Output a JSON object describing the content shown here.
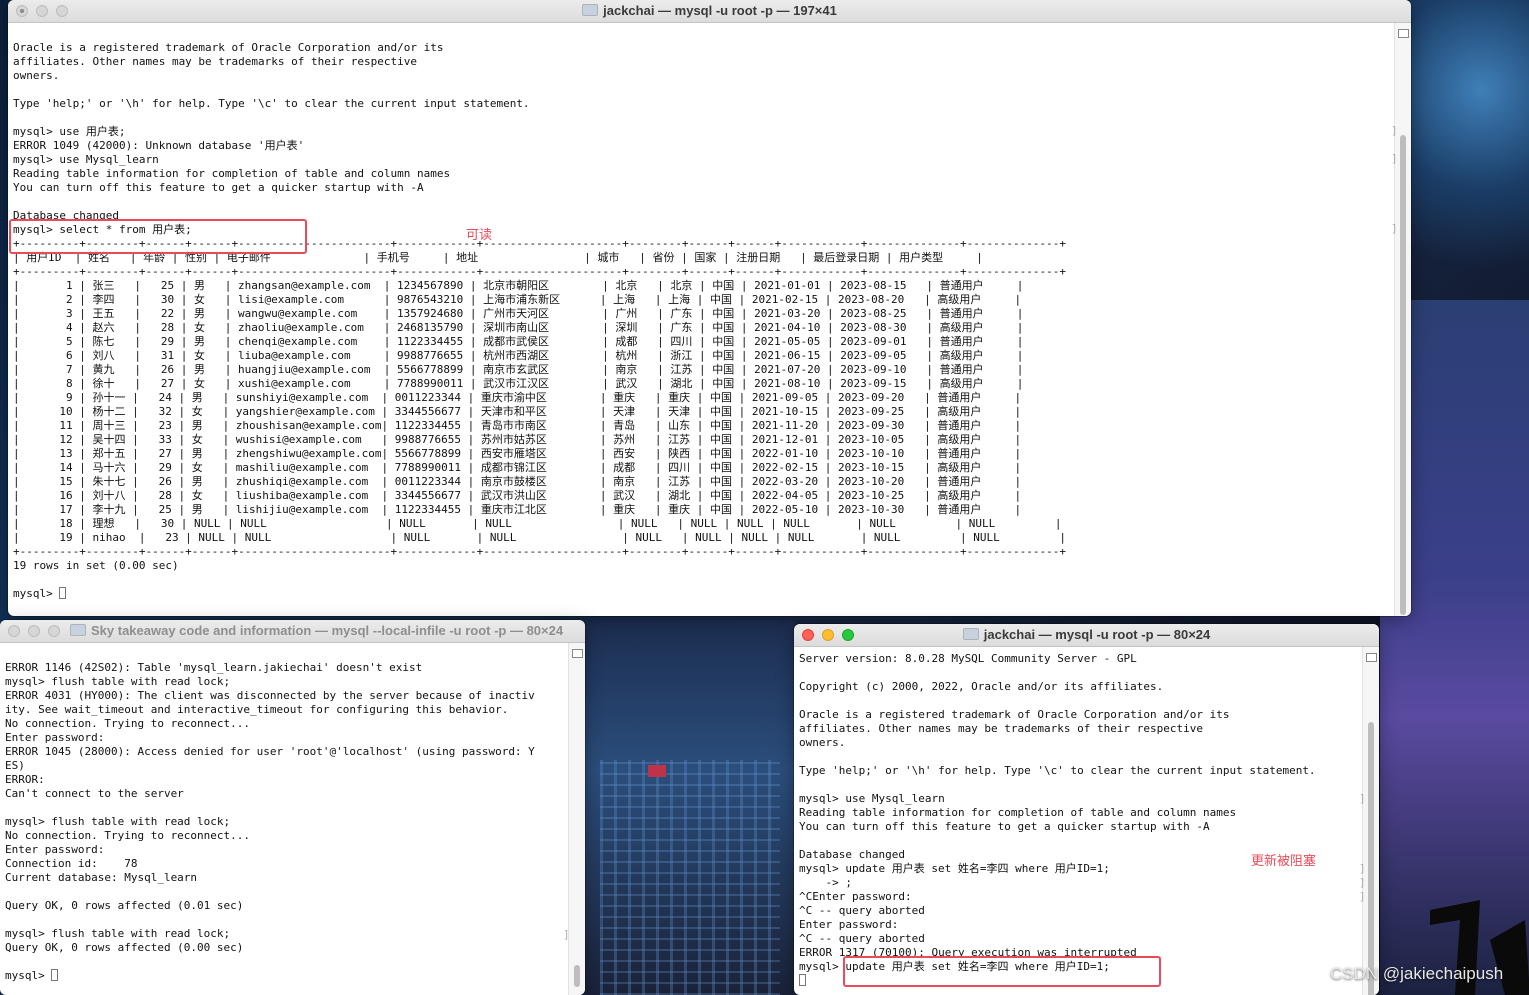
{
  "windows": {
    "main": {
      "title": "jackchai — mysql -u root -p — 197×41",
      "lines": [
        "",
        "Oracle is a registered trademark of Oracle Corporation and/or its",
        "affiliates. Other names may be trademarks of their respective",
        "owners.",
        "",
        "Type 'help;' or '\\h' for help. Type '\\c' to clear the current input statement.",
        "",
        "mysql> use 用户表;",
        "ERROR 1049 (42000): Unknown database '用户表'",
        "mysql> use Mysql_learn",
        "Reading table information for completion of table and column names",
        "You can turn off this feature to get a quicker startup with -A",
        "",
        "Database changed",
        "mysql> select * from 用户表;",
        "+---------+--------+------+------+-----------------------+------------+---------------------+--------+------+------+------------+--------------+--------------+",
        "| 用户ID  | 姓名   | 年龄 | 性别 | 电子邮件              | 手机号     | 地址                | 城市   | 省份 | 国家 | 注册日期   | 最后登录日期 | 用户类型     |",
        "+---------+--------+------+------+-----------------------+------------+---------------------+--------+------+------+------------+--------------+--------------+",
        "|       1 | 张三   |   25 | 男   | zhangsan@example.com  | 1234567890 | 北京市朝阳区        | 北京   | 北京 | 中国 | 2021-01-01 | 2023-08-15   | 普通用户     |",
        "|       2 | 李四   |   30 | 女   | lisi@example.com      | 9876543210 | 上海市浦东新区      | 上海   | 上海 | 中国 | 2021-02-15 | 2023-08-20   | 高级用户     |",
        "|       3 | 王五   |   22 | 男   | wangwu@example.com    | 1357924680 | 广州市天河区        | 广州   | 广东 | 中国 | 2021-03-20 | 2023-08-25   | 普通用户     |",
        "|       4 | 赵六   |   28 | 女   | zhaoliu@example.com   | 2468135790 | 深圳市南山区        | 深圳   | 广东 | 中国 | 2021-04-10 | 2023-08-30   | 高级用户     |",
        "|       5 | 陈七   |   29 | 男   | chenqi@example.com    | 1122334455 | 成都市武侯区        | 成都   | 四川 | 中国 | 2021-05-05 | 2023-09-01   | 普通用户     |",
        "|       6 | 刘八   |   31 | 女   | liuba@example.com     | 9988776655 | 杭州市西湖区        | 杭州   | 浙江 | 中国 | 2021-06-15 | 2023-09-05   | 高级用户     |",
        "|       7 | 黄九   |   26 | 男   | huangjiu@example.com  | 5566778899 | 南京市玄武区        | 南京   | 江苏 | 中国 | 2021-07-20 | 2023-09-10   | 普通用户     |",
        "|       8 | 徐十   |   27 | 女   | xushi@example.com     | 7788990011 | 武汉市江汉区        | 武汉   | 湖北 | 中国 | 2021-08-10 | 2023-09-15   | 高级用户     |",
        "|       9 | 孙十一 |   24 | 男   | sunshiyi@example.com  | 0011223344 | 重庆市渝中区        | 重庆   | 重庆 | 中国 | 2021-09-05 | 2023-09-20   | 普通用户     |",
        "|      10 | 杨十二 |   32 | 女   | yangshier@example.com | 3344556677 | 天津市和平区        | 天津   | 天津 | 中国 | 2021-10-15 | 2023-09-25   | 高级用户     |",
        "|      11 | 周十三 |   23 | 男   | zhoushisan@example.com| 1122334455 | 青岛市市南区        | 青岛   | 山东 | 中国 | 2021-11-20 | 2023-09-30   | 普通用户     |",
        "|      12 | 吴十四 |   33 | 女   | wushisi@example.com   | 9988776655 | 苏州市姑苏区        | 苏州   | 江苏 | 中国 | 2021-12-01 | 2023-10-05   | 高级用户     |",
        "|      13 | 郑十五 |   27 | 男   | zhengshiwu@example.com| 5566778899 | 西安市雁塔区        | 西安   | 陕西 | 中国 | 2022-01-10 | 2023-10-10   | 普通用户     |",
        "|      14 | 马十六 |   29 | 女   | mashiliu@example.com  | 7788990011 | 成都市锦江区        | 成都   | 四川 | 中国 | 2022-02-15 | 2023-10-15   | 高级用户     |",
        "|      15 | 朱十七 |   26 | 男   | zhushiqi@example.com  | 0011223344 | 南京市鼓楼区        | 南京   | 江苏 | 中国 | 2022-03-20 | 2023-10-20   | 普通用户     |",
        "|      16 | 刘十八 |   28 | 女   | liushiba@example.com  | 3344556677 | 武汉市洪山区        | 武汉   | 湖北 | 中国 | 2022-04-05 | 2023-10-25   | 高级用户     |",
        "|      17 | 李十九 |   25 | 男   | lishijiu@example.com  | 1122334455 | 重庆市江北区        | 重庆   | 重庆 | 中国 | 2022-05-10 | 2023-10-30   | 普通用户     |",
        "|      18 | 理想   |   30 | NULL | NULL                  | NULL       | NULL                | NULL   | NULL | NULL | NULL       | NULL         | NULL         |",
        "|      19 | nihao  |   23 | NULL | NULL                  | NULL       | NULL                | NULL   | NULL | NULL | NULL       | NULL         | NULL         |",
        "+---------+--------+------+------+-----------------------+------------+---------------------+--------+------+------+------------+--------------+--------------+",
        "19 rows in set (0.00 sec)",
        "",
        "mysql> "
      ],
      "annotation": "可读"
    },
    "left": {
      "title": "Sky takeaway code and information — mysql --local-infile -u root -p — 80×24",
      "lines": [
        "",
        "ERROR 1146 (42S02): Table 'mysql_learn.jakiechai' doesn't exist",
        "mysql> flush table with read lock;",
        "ERROR 4031 (HY000): The client was disconnected by the server because of inactiv",
        "ity. See wait_timeout and interactive_timeout for configuring this behavior.",
        "No connection. Trying to reconnect...",
        "Enter password:",
        "ERROR 1045 (28000): Access denied for user 'root'@'localhost' (using password: Y",
        "ES)",
        "ERROR:",
        "Can't connect to the server",
        "",
        "mysql> flush table with read lock;",
        "No connection. Trying to reconnect...",
        "Enter password:",
        "Connection id:    78",
        "Current database: Mysql_learn",
        "",
        "Query OK, 0 rows affected (0.01 sec)",
        "",
        "mysql> flush table with read lock;",
        "Query OK, 0 rows affected (0.00 sec)",
        "",
        "mysql> "
      ]
    },
    "right": {
      "title": "jackchai — mysql -u root -p — 80×24",
      "lines": [
        "Server version: 8.0.28 MySQL Community Server - GPL",
        "",
        "Copyright (c) 2000, 2022, Oracle and/or its affiliates.",
        "",
        "Oracle is a registered trademark of Oracle Corporation and/or its",
        "affiliates. Other names may be trademarks of their respective",
        "owners.",
        "",
        "Type 'help;' or '\\h' for help. Type '\\c' to clear the current input statement.",
        "",
        "mysql> use Mysql_learn",
        "Reading table information for completion of table and column names",
        "You can turn off this feature to get a quicker startup with -A",
        "",
        "Database changed",
        "mysql> update 用户表 set 姓名=李四 where 用户ID=1;",
        "    -> ;",
        "^CEnter password:",
        "^C -- query aborted",
        "Enter password:",
        "^C -- query aborted",
        "ERROR 1317 (70100): Query execution was interrupted",
        "mysql> update 用户表 set 姓名=李四 where 用户ID=1;",
        ""
      ],
      "annotation": "更新被阻塞"
    }
  },
  "watermark": "CSDN @jakiechaipush",
  "colors": {
    "annotation": "#e84c5a",
    "close": "#fe5f57",
    "minimize": "#febc2e",
    "zoom": "#28c840"
  }
}
